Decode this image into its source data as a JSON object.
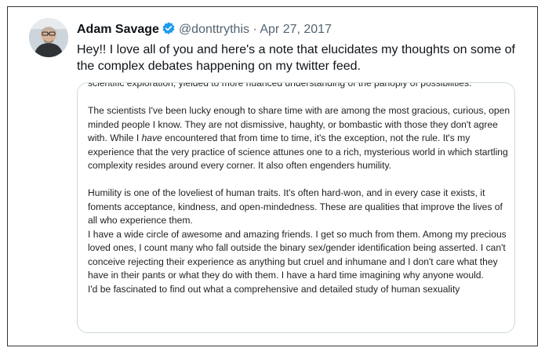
{
  "tweet": {
    "author_name": "Adam Savage",
    "handle": "@donttrythis",
    "separator": "·",
    "date": "Apr 27, 2017",
    "text": "Hey!! I love all of you and here's a note that elucidates my thoughts on some of the complex debates happening on my twitter feed."
  },
  "note": {
    "line_top": "scientific exploration, yielded to more nuanced understanding of the panoply of possibilities.",
    "p1_a": "The scientists I've been lucky enough to share time with are among the most gracious, curious, open minded people I know. They are not dismissive, haughty, or bombastic with those they don't agree with. While I ",
    "p1_em": "have",
    "p1_b": " encountered that from time to time, it's the exception, not the rule. It's my experience that the very practice of science attunes one to a rich, mysterious world in which startling complexity resides around every corner. It also often engenders humility.",
    "p2": "Humility is one of the loveliest of human traits. It's often hard-won, and in every case it exists, it foments acceptance, kindness, and open-mindedness. These are qualities that improve the lives of all who experience them.",
    "p3": "I have a wide circle of awesome and amazing friends. I get so much from them. Among my precious loved ones, I count many who fall outside the binary sex/gender identification being asserted. I can't conceive rejecting their experience as anything but cruel and inhumane and I don't care what they have in their pants or what they do with them. I have a hard time imagining why anyone would.",
    "line_bottom": "I'd be fascinated to find out what a comprehensive and detailed study of human sexuality"
  },
  "colors": {
    "text": "#0f1419",
    "muted": "#536471",
    "verified_badge": "#1d9bf0",
    "media_border": "#cfd9de"
  },
  "icons": {
    "verified": "verified-badge-icon",
    "avatar": "profile-avatar"
  }
}
